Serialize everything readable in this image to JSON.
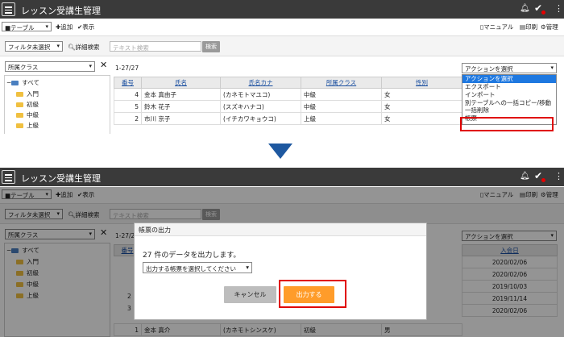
{
  "app": {
    "title": "レッスン受講生管理",
    "bell_icon": "bell-icon",
    "check_icon": "check-icon",
    "menu_icon": "kebab-icon"
  },
  "toolbar": {
    "view_select": "■テーブル",
    "add_label": "✚追加",
    "display_label": "✔表示",
    "manual_label": "マニュアル",
    "print_label": "印刷",
    "admin_label": "管理"
  },
  "filter": {
    "filter_select": "フィルタ未選択",
    "detail_search_label": "詳細検索",
    "text_search_placeholder": "テキスト検索",
    "search_button": "検索"
  },
  "tree": {
    "select_label": "所属クラス",
    "items": [
      "すべて",
      "入門",
      "初級",
      "中級",
      "上級"
    ]
  },
  "list": {
    "count_label": "1-27/27",
    "action_select": "アクションを選択",
    "action_options": [
      "アクションを選択",
      "エクスポート",
      "インポート",
      "別テーブルへの一括コピー/移動",
      "一括削除",
      "帳票"
    ],
    "headers": [
      "番号",
      "氏名",
      "氏名カナ",
      "所属クラス",
      "性別"
    ],
    "rows": [
      [
        "4",
        "金本 真由子",
        "(カネモトマユコ)",
        "中級",
        "女"
      ],
      [
        "5",
        "鈴木 花子",
        "(スズキハナコ)",
        "中級",
        "女"
      ],
      [
        "2",
        "市川 京子",
        "(イチカワキョウコ)",
        "上級",
        "女"
      ]
    ]
  },
  "panel2": {
    "headers": [
      "番号",
      "入会日"
    ],
    "dates": [
      "2020/02/06",
      "2020/02/06",
      "2019/10/03",
      "2019/11/14",
      "2020/02/06"
    ],
    "row_numbers": [
      "2",
      "3"
    ],
    "last_row": [
      "1",
      "金本 真介",
      "(カネモトシンスケ)",
      "初級",
      "男"
    ]
  },
  "dialog": {
    "title": "帳票の出力",
    "message": "27 件のデータを出力します。",
    "report_select": "出力する帳票を選択してください",
    "cancel_label": "キャンセル",
    "output_label": "出力する"
  },
  "colors": {
    "titlebar": "#3a3a3a",
    "highlight": "#e00000",
    "accent_button": "#ff9c2a",
    "selected_option": "#1e78e0",
    "arrow": "#1e58a0"
  }
}
